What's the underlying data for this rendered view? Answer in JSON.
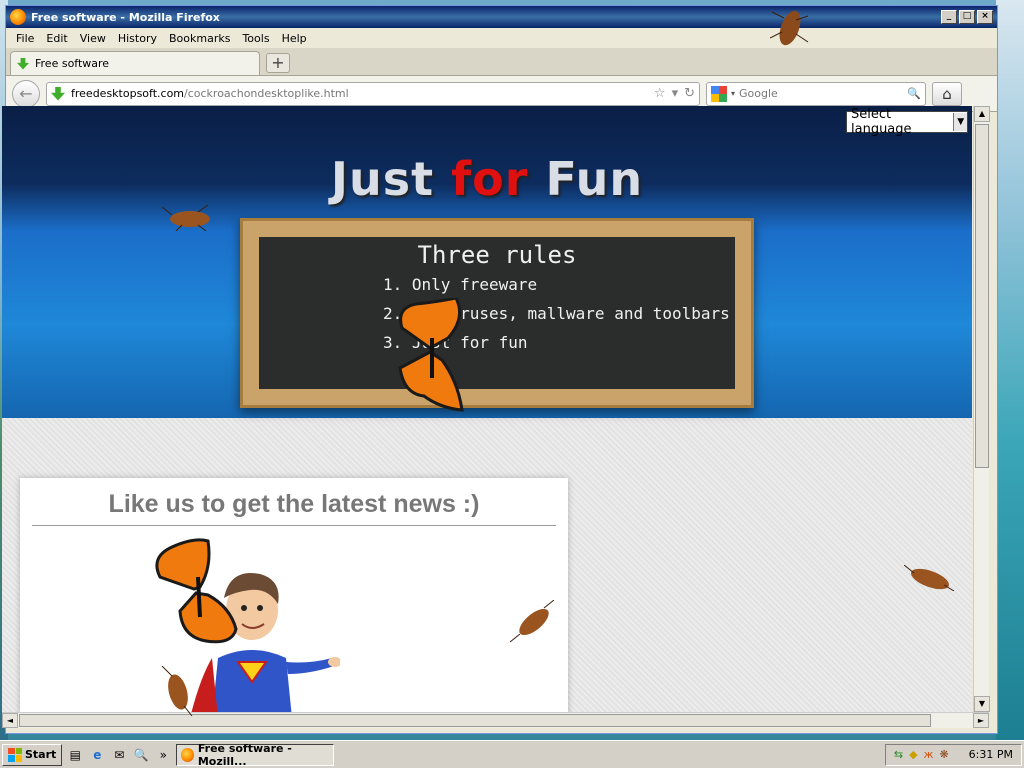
{
  "window": {
    "title": "Free software - Mozilla Firefox",
    "buttons": {
      "minimize": "_",
      "maximize": "□",
      "close": "×"
    }
  },
  "menu": [
    {
      "label": "File"
    },
    {
      "label": "Edit"
    },
    {
      "label": "View"
    },
    {
      "label": "History"
    },
    {
      "label": "Bookmarks"
    },
    {
      "label": "Tools"
    },
    {
      "label": "Help"
    }
  ],
  "tab": {
    "label": "Free software",
    "new_tab": "+"
  },
  "address": {
    "host": "freedesktopsoft.com",
    "path": "/cockroachondesktoplike.html"
  },
  "search": {
    "placeholder": "Google"
  },
  "page": {
    "language_select": "Select language",
    "hero": {
      "part1": "Just ",
      "accent": "for",
      "part2": " Fun"
    },
    "board": {
      "title": "Three rules",
      "rules": [
        "1. Only freeware",
        "2. No viruses, mallware and toolbars",
        "3. Just for fun"
      ]
    },
    "like_title": "Like us to get the latest news :)"
  },
  "taskbar": {
    "start": "Start",
    "quick_launch_more": "»",
    "task": "Free software - Mozill...",
    "clock": "6:31 PM"
  },
  "colors": {
    "accent_red": "#e01010",
    "hero_blue": "#1f88d8",
    "titlebar": "#0a246a"
  }
}
